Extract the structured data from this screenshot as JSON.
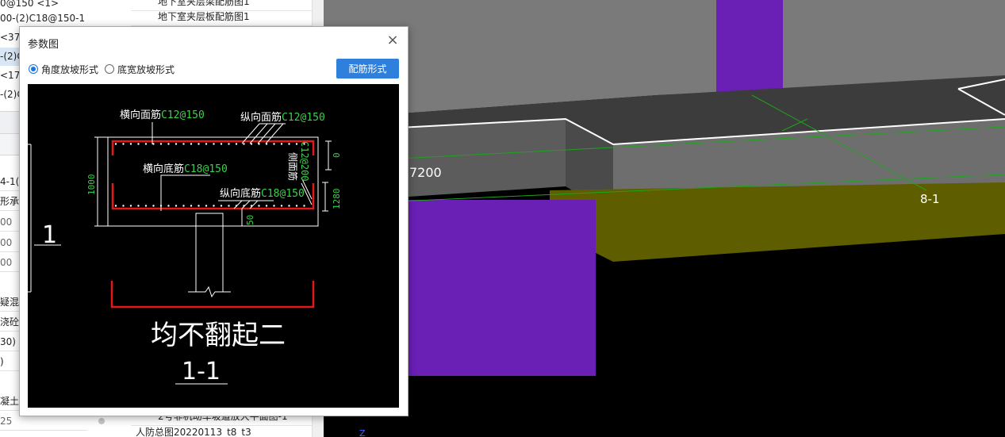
{
  "left_panel": {
    "rows": [
      {
        "text": "0@150 <1>"
      },
      {
        "text": "00-(2)C18@150-1"
      },
      {
        "text": "<37"
      },
      {
        "text": "-(2)C"
      },
      {
        "text": "<17"
      },
      {
        "text": "-(2)C"
      },
      {
        "text": "4-1("
      },
      {
        "text": "形承"
      },
      {
        "text": "00"
      },
      {
        "text": "00"
      },
      {
        "text": "00"
      },
      {
        "text": "疑混"
      },
      {
        "text": "浇砼"
      },
      {
        "text": "30)"
      },
      {
        "text": ")"
      },
      {
        "text": "凝土"
      },
      {
        "text": "25"
      }
    ]
  },
  "mid_panel": {
    "rows": [
      {
        "text": "地下室夹层梁配筋图1"
      },
      {
        "text": "地下室夹层板配筋图1"
      },
      {
        "text": "2号非机动车坡道放大平面图-1"
      },
      {
        "text": "人防总图20220113_t8_t3"
      }
    ]
  },
  "viewport": {
    "label_span": "7200",
    "label_axis": "8-1",
    "label_z": "Z",
    "colors": {
      "slab_top": "#3a3a3a",
      "slab_side": "#6e6e6e",
      "beam_yellow": "#5e5e00",
      "column_purple": "#6a1fb5",
      "gray_wall": "#7a7a7a"
    }
  },
  "dialog": {
    "title": "参数图",
    "close_icon": "×",
    "radio_angle": "角度放坡形式",
    "radio_width": "底宽放坡形式",
    "selected": "角度放坡形式",
    "rebar_button": "配筋形式",
    "drawing": {
      "transverse_top": "横向面筋",
      "transverse_top_spec": "C12@150",
      "longitudinal_top": "纵向面筋",
      "longitudinal_top_spec": "C12@150",
      "side_bar": "侧面筋",
      "side_bar_spec": "C12@200",
      "transverse_bottom": "横向底筋",
      "transverse_bottom_spec": "C18@150",
      "longitudinal_bottom": "纵向底筋",
      "longitudinal_bottom_spec": "C18@150",
      "dim_height": "1000",
      "dim_top": "0",
      "dim_side": "1280",
      "dim_bottom": "50",
      "section_mark": "1",
      "note": "均不翻起二",
      "section_title": "1-1"
    }
  }
}
